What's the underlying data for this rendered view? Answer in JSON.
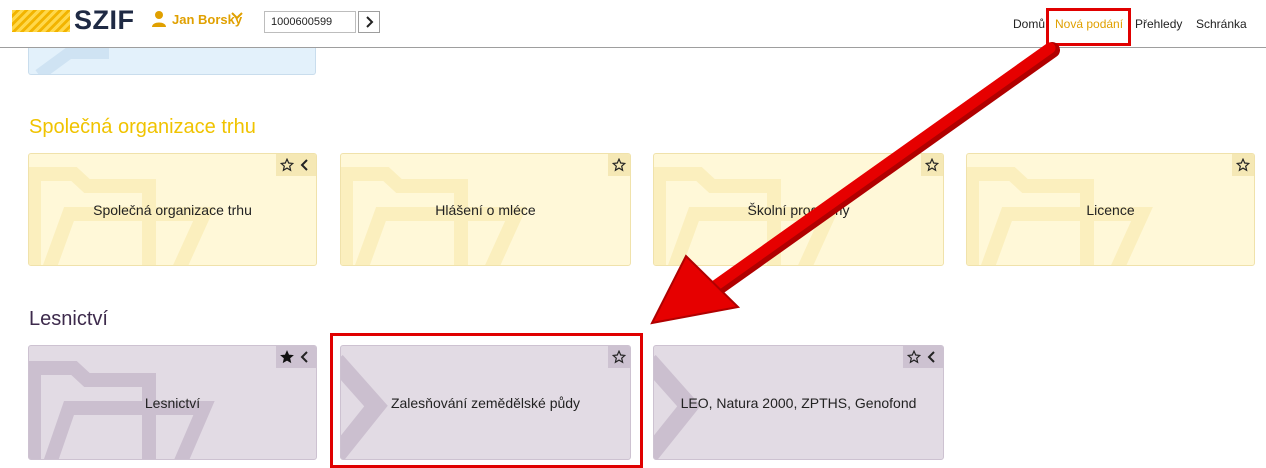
{
  "header": {
    "logo_text": "SZIF",
    "user_name": "Jan Borský",
    "search_value": "1000600599",
    "nav": {
      "home": "Domů",
      "new_submissions": "Nová podání",
      "overviews": "Přehledy",
      "inbox": "Schránka"
    }
  },
  "sections": [
    {
      "title": "Společná organizace trhu",
      "tiles": [
        {
          "label": "Společná organizace trhu",
          "favorite": false,
          "has_back": true
        },
        {
          "label": "Hlášení o mléce",
          "favorite": false,
          "has_back": false
        },
        {
          "label": "Školní programy",
          "favorite": false,
          "has_back": false
        },
        {
          "label": "Licence",
          "favorite": false,
          "has_back": false
        }
      ]
    },
    {
      "title": "Lesnictví",
      "tiles": [
        {
          "label": "Lesnictví",
          "favorite": true,
          "has_back": true
        },
        {
          "label": "Zalesňování zemědělské půdy",
          "favorite": false,
          "has_back": false
        },
        {
          "label": "LEO, Natura 2000, ZPTHS, Genofond",
          "favorite": false,
          "has_back": true
        }
      ]
    }
  ],
  "colors": {
    "accent": "#e0a000",
    "section_yellow": "#f0c300",
    "section_purple": "#3d2a4c",
    "annotation_red": "#e00000"
  },
  "icons": {
    "favorite": "star-icon",
    "favorite_filled": "star-filled-icon",
    "back": "chevron-left-icon",
    "folder": "folder-icon",
    "arrow": "chevron-right-icon"
  }
}
